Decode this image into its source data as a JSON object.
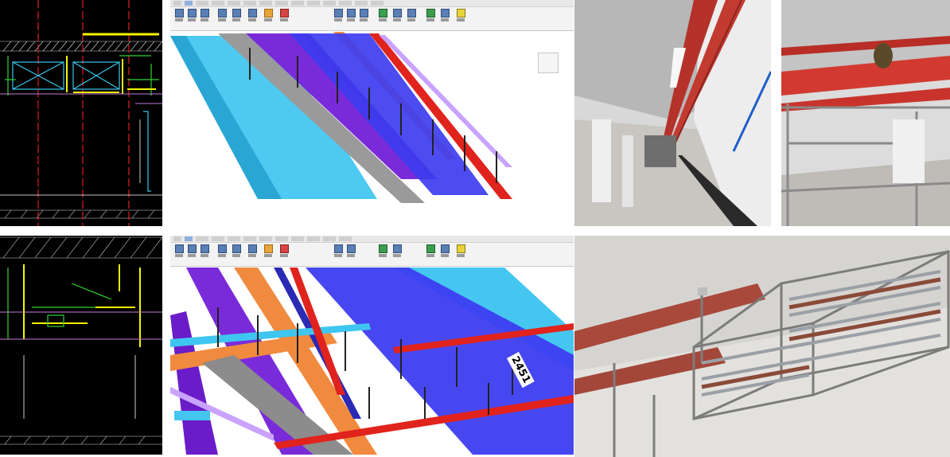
{
  "image": {
    "panels": [
      {
        "id": "cad-top",
        "kind": "cad-drawing"
      },
      {
        "id": "bim-top",
        "kind": "bim-model"
      },
      {
        "id": "photo-corridor",
        "kind": "site-photo"
      },
      {
        "id": "photo-scaffold",
        "kind": "site-photo"
      },
      {
        "id": "cad-bottom",
        "kind": "cad-drawing"
      },
      {
        "id": "bim-bottom",
        "kind": "bim-model"
      },
      {
        "id": "photo-trays",
        "kind": "site-photo"
      }
    ],
    "bim_bottom_label": "2451",
    "colors": {
      "cad_background": "#000000",
      "pipe_red": "#e0231c",
      "duct_cyan": "#3fc6f0",
      "duct_blue": "#3d3df0",
      "duct_purple": "#7a2bd9",
      "duct_orange": "#f08a3e",
      "tray_grey": "#8c8c8c",
      "pipe_lavender": "#c9a3ff"
    }
  }
}
